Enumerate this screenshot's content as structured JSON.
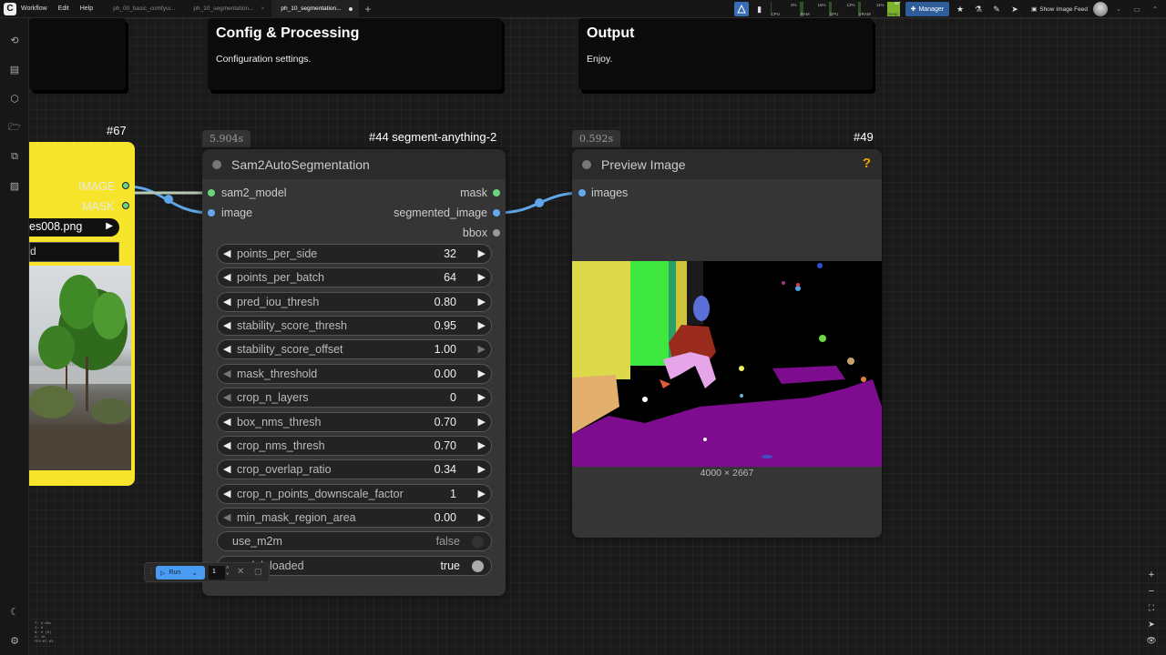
{
  "menubar": {
    "logo": "C",
    "items": [
      "Workflow",
      "Edit",
      "Help"
    ],
    "tabs": [
      {
        "label": "ph_00_basic_comfyui...",
        "active": false
      },
      {
        "label": "ph_10_segmentation...",
        "active": false
      },
      {
        "label": "ph_10_segmentation...",
        "active": true
      }
    ],
    "add_tab": "+",
    "meters": [
      {
        "label": "CPU",
        "value": "3%",
        "fraction": 0.03
      },
      {
        "label": "RAM",
        "value": "16%",
        "fraction": 0.16
      },
      {
        "label": "GPU",
        "value": "12%",
        "fraction": 0.12
      },
      {
        "label": "VRAM",
        "value": "11%",
        "fraction": 0.11
      },
      {
        "label": "Temp",
        "value": "45°",
        "fraction": 0.45
      }
    ],
    "manager_label": "Manager",
    "feed_label": "Show Image Feed"
  },
  "canvas_stats": [
    "T: 0.00s",
    "I: 0",
    "N: 6 [6]",
    "V: 16",
    "FPS:67.65"
  ],
  "groups": [
    {
      "title": "",
      "desc": ""
    },
    {
      "title": "Config & Processing",
      "desc": "Configuration settings."
    },
    {
      "title": "Output",
      "desc": "Enjoy."
    }
  ],
  "load_node": {
    "id": "#67",
    "outputs": [
      "IMAGE",
      "MASK"
    ],
    "filename": "es008.png",
    "upload_label": "d"
  },
  "sam_node": {
    "time": "5.904s",
    "id": "#44 segment-anything-2",
    "title": "Sam2AutoSegmentation",
    "inputs": [
      "sam2_model",
      "image"
    ],
    "outputs": [
      "mask",
      "segmented_image",
      "bbox"
    ],
    "widgets": [
      {
        "name": "points_per_side",
        "value": "32"
      },
      {
        "name": "points_per_batch",
        "value": "64"
      },
      {
        "name": "pred_iou_thresh",
        "value": "0.80"
      },
      {
        "name": "stability_score_thresh",
        "value": "0.95"
      },
      {
        "name": "stability_score_offset",
        "value": "1.00"
      },
      {
        "name": "mask_threshold",
        "value": "0.00"
      },
      {
        "name": "crop_n_layers",
        "value": "0"
      },
      {
        "name": "box_nms_thresh",
        "value": "0.70"
      },
      {
        "name": "crop_nms_thresh",
        "value": "0.70"
      },
      {
        "name": "crop_overlap_ratio",
        "value": "0.34"
      },
      {
        "name": "crop_n_points_downscale_factor",
        "value": "1"
      },
      {
        "name": "min_mask_region_area",
        "value": "0.00"
      }
    ],
    "toggles": [
      {
        "name": "use_m2m",
        "value": "false"
      },
      {
        "name": "model_loaded",
        "value": "true"
      }
    ]
  },
  "preview_node": {
    "time": "0.592s",
    "id": "#49",
    "title": "Preview Image",
    "help": "?",
    "input": "images",
    "dimensions": "4000 × 2667"
  },
  "runbar": {
    "run_label": "Run",
    "count": "1"
  },
  "colors": {
    "canvas": "#1a1a1a",
    "node_body": "#353535",
    "load_node": "#f7e52b",
    "link_blue": "#5ea6e8",
    "run_button": "#4a9bf2"
  }
}
